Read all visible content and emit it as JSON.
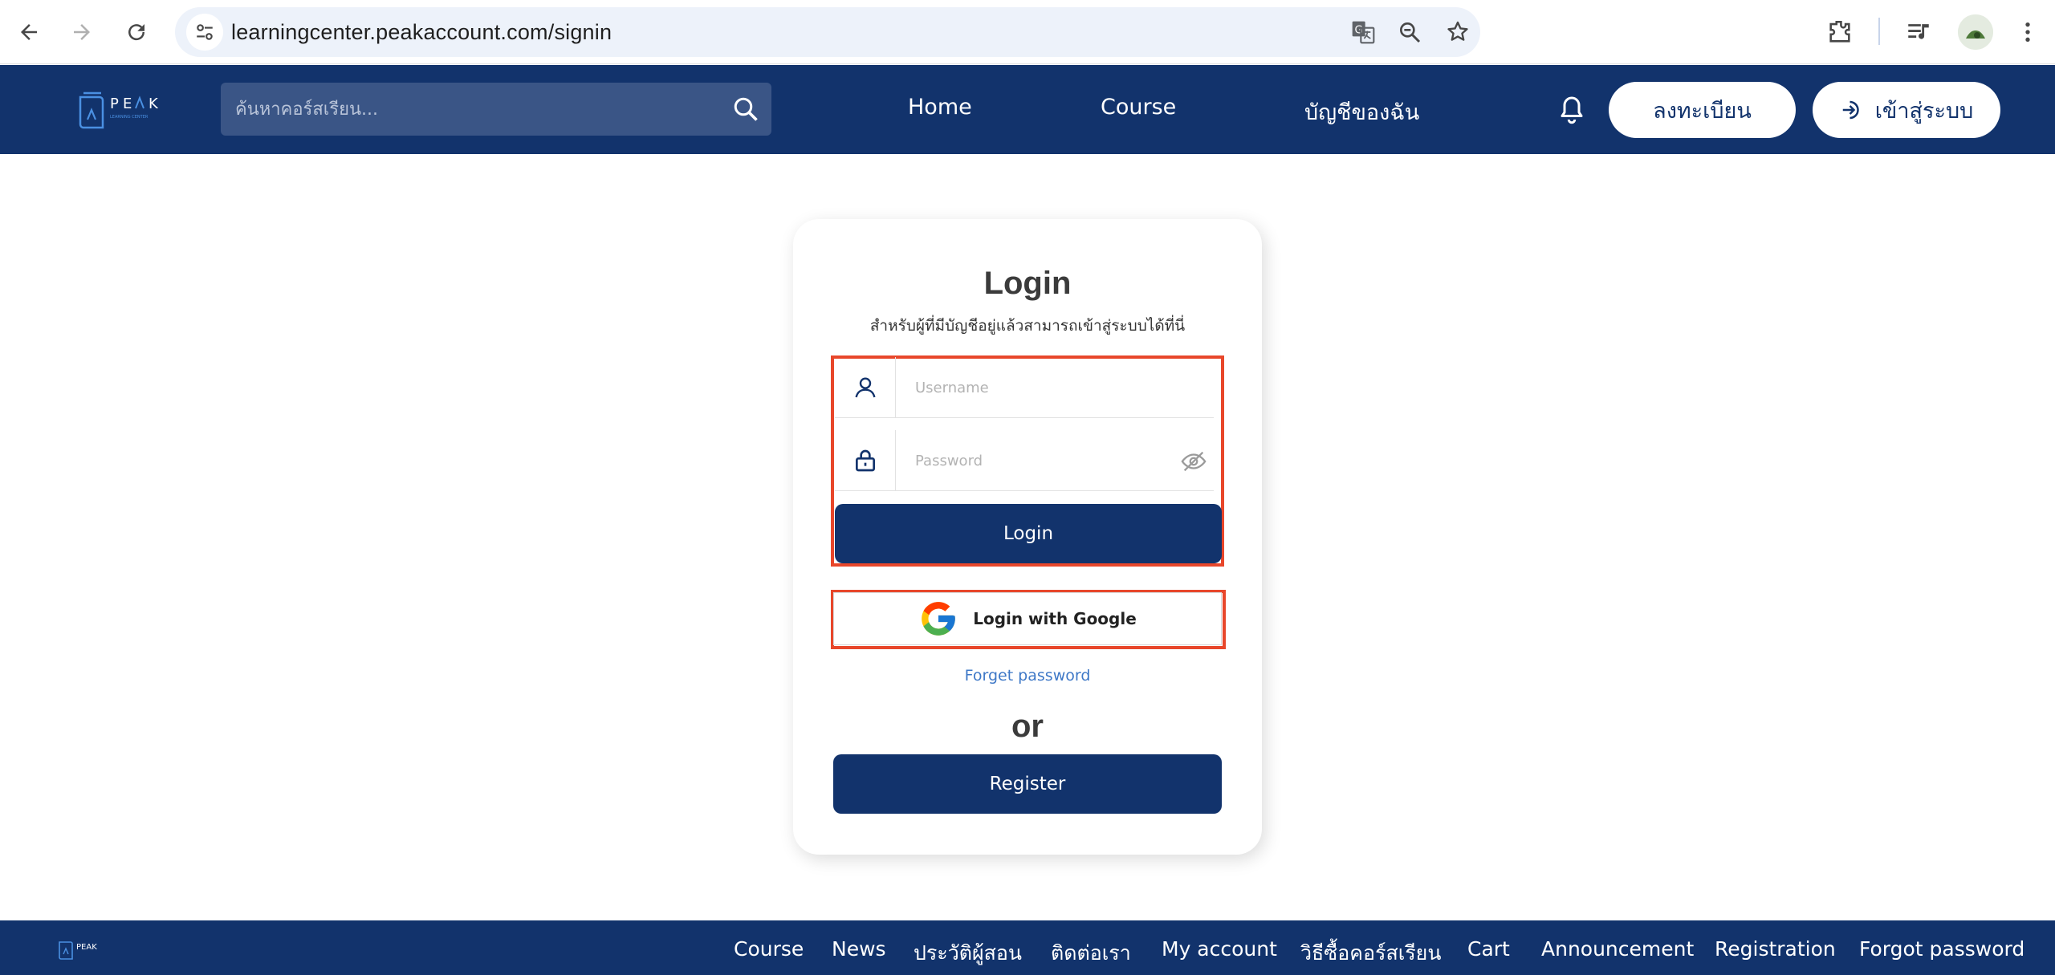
{
  "browser": {
    "url": "learningcenter.peakaccount.com/signin",
    "icons": [
      "back-arrow-icon",
      "forward-arrow-icon",
      "reload-icon",
      "site-settings-icon",
      "translate-icon",
      "zoom-icon",
      "bookmark-star-icon",
      "extensions-icon",
      "media-controls-icon",
      "profile-avatar",
      "more-vert-icon"
    ]
  },
  "header": {
    "logo_text": "PEAK",
    "logo_subtext": "LEARNING CENTER",
    "search_placeholder": "ค้นหาคอร์สเรียน...",
    "nav": {
      "home": "Home",
      "course": "Course",
      "my_account": "บัญชีของฉัน"
    },
    "register_label": "ลงทะเบียน",
    "signin_label": "เข้าสู่ระบบ"
  },
  "login": {
    "title": "Login",
    "subtitle": "สำหรับผู้ที่มีบัญชีอยู่แล้วสามารถเข้าสู่ระบบได้ที่นี่",
    "username_placeholder": "Username",
    "password_placeholder": "Password",
    "login_button": "Login",
    "google_button": "Login with Google",
    "forget_password": "Forget password",
    "or_text": "or",
    "register_button": "Register"
  },
  "footer": {
    "logo_text": "PEAK",
    "links": {
      "course": "Course",
      "news": "News",
      "instructors": "ประวัติผู้สอน",
      "contact": "ติดต่อเรา",
      "my_account": "My account",
      "how_to_buy": "วิธีซื้อคอร์สเรียน",
      "cart": "Cart",
      "announcement": "Announcement",
      "registration": "Registration",
      "forgot_password": "Forgot password"
    }
  },
  "colors": {
    "brand_navy": "#12336c",
    "search_bg": "#3a5586",
    "highlight_red": "#e8472b",
    "link_blue": "#3e78c7",
    "omnibox_bg": "#edf2fa"
  }
}
